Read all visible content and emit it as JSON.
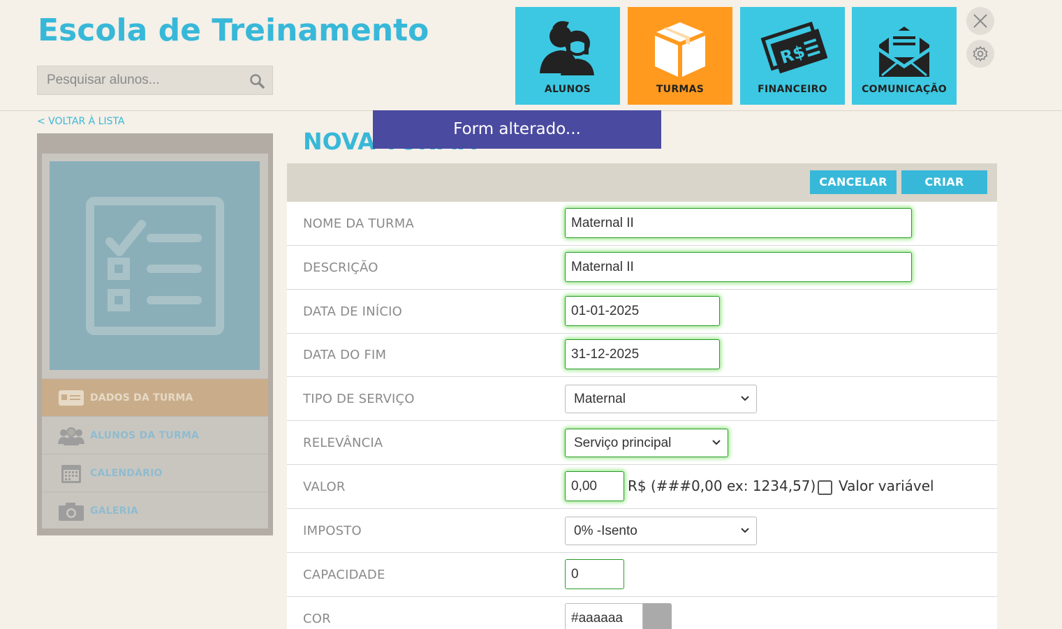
{
  "header": {
    "brand": "Escola de Treinamento",
    "search_placeholder": "Pesquisar alunos...",
    "nav": [
      {
        "label": "ALUNOS",
        "icon": "students-icon",
        "active": false
      },
      {
        "label": "TURMAS",
        "icon": "box-icon",
        "active": true
      },
      {
        "label": "FINANCEIRO",
        "icon": "money-icon",
        "active": false
      },
      {
        "label": "COMUNICAÇÃO",
        "icon": "envelope-icon",
        "active": false
      }
    ]
  },
  "toast": "Form alterado...",
  "back_link": "< VOLTAR À LISTA",
  "sidebar": {
    "items": [
      {
        "label": "DADOS DA TURMA",
        "icon": "id-card-icon",
        "active": true
      },
      {
        "label": "ALUNOS DA TURMA",
        "icon": "group-icon",
        "active": false
      },
      {
        "label": "CALENDÁRIO",
        "icon": "calendar-icon",
        "active": false
      },
      {
        "label": "GALERIA",
        "icon": "camera-icon",
        "active": false
      }
    ]
  },
  "page_title": "NOVA TURMA",
  "actions": {
    "cancel": "CANCELAR",
    "create": "CRIAR"
  },
  "form": {
    "nome": {
      "label": "NOME DA TURMA",
      "value": "Maternal II"
    },
    "descricao": {
      "label": "DESCRIÇÃO",
      "value": "Maternal II"
    },
    "data_inicio": {
      "label": "DATA DE INÍCIO",
      "value": "01-01-2025"
    },
    "data_fim": {
      "label": "DATA DO FIM",
      "value": "31-12-2025"
    },
    "tipo_servico": {
      "label": "TIPO DE SERVIÇO",
      "value": "Maternal"
    },
    "relevancia": {
      "label": "RELEVÂNCIA",
      "value": "Serviço principal"
    },
    "valor": {
      "label": "VALOR",
      "value": "0,00",
      "hint": "R$ (###0,00 ex: 1234,57)",
      "checkbox_label": "Valor variável",
      "checked": false
    },
    "imposto": {
      "label": "IMPOSTO",
      "value": "0% -Isento"
    },
    "capacidade": {
      "label": "CAPACIDADE",
      "value": "0"
    },
    "cor": {
      "label": "COR",
      "value": "#aaaaaa"
    }
  },
  "colors": {
    "accent": "#38b8d8",
    "active_tile": "#ff9a1e",
    "toast": "#4a4aa0",
    "color_swatch": "#aaaaaa"
  }
}
